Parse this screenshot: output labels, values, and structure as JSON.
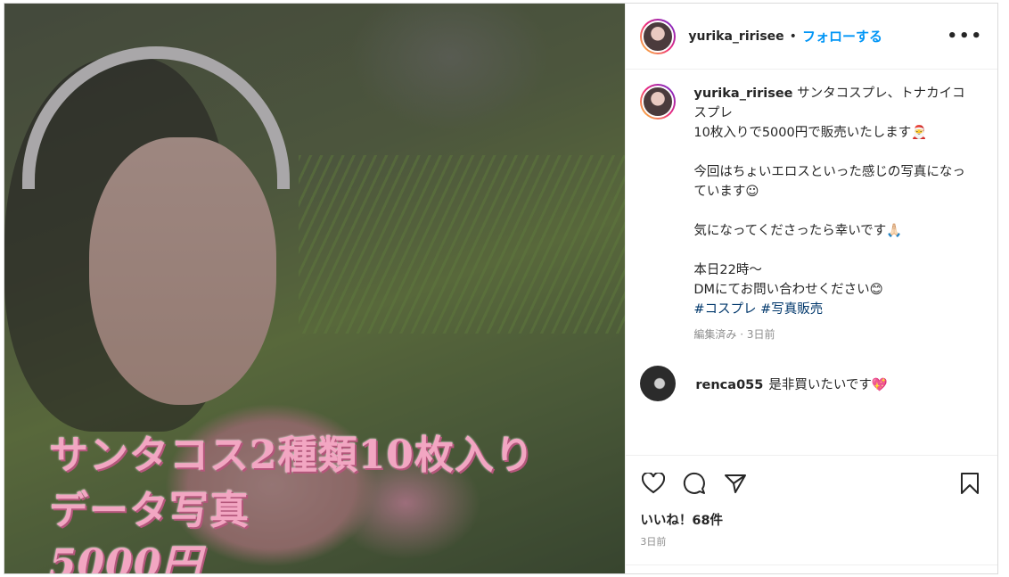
{
  "post": {
    "username": "yurika_ririsee",
    "follow_label": "フォローする",
    "more_label": "•••",
    "overlay_lines": [
      "サンタコス2種類10枚入り",
      "データ写真",
      "5000円"
    ],
    "caption": {
      "username": "yurika_ririsee",
      "text": " サンタコスプレ、トナカイコスプレ\n10枚入りで5000円で販売いたします🎅\n\n今回はちょいエロスといった感じの写真になっています☺\n\n気になってくださったら幸いです🙏🏻\n\n本日22時〜\nDMにてお問い合わせください😊\n",
      "hashtags": [
        "#コスプレ",
        "#写真販売"
      ],
      "meta": "編集済み · 3日前"
    },
    "comment": {
      "username": "renca055",
      "text": "是非買いたいです💖"
    },
    "likes": "いいね！68件",
    "time": "3日前",
    "icons": [
      "heart-icon",
      "comment-icon",
      "share-icon",
      "bookmark-icon"
    ]
  }
}
